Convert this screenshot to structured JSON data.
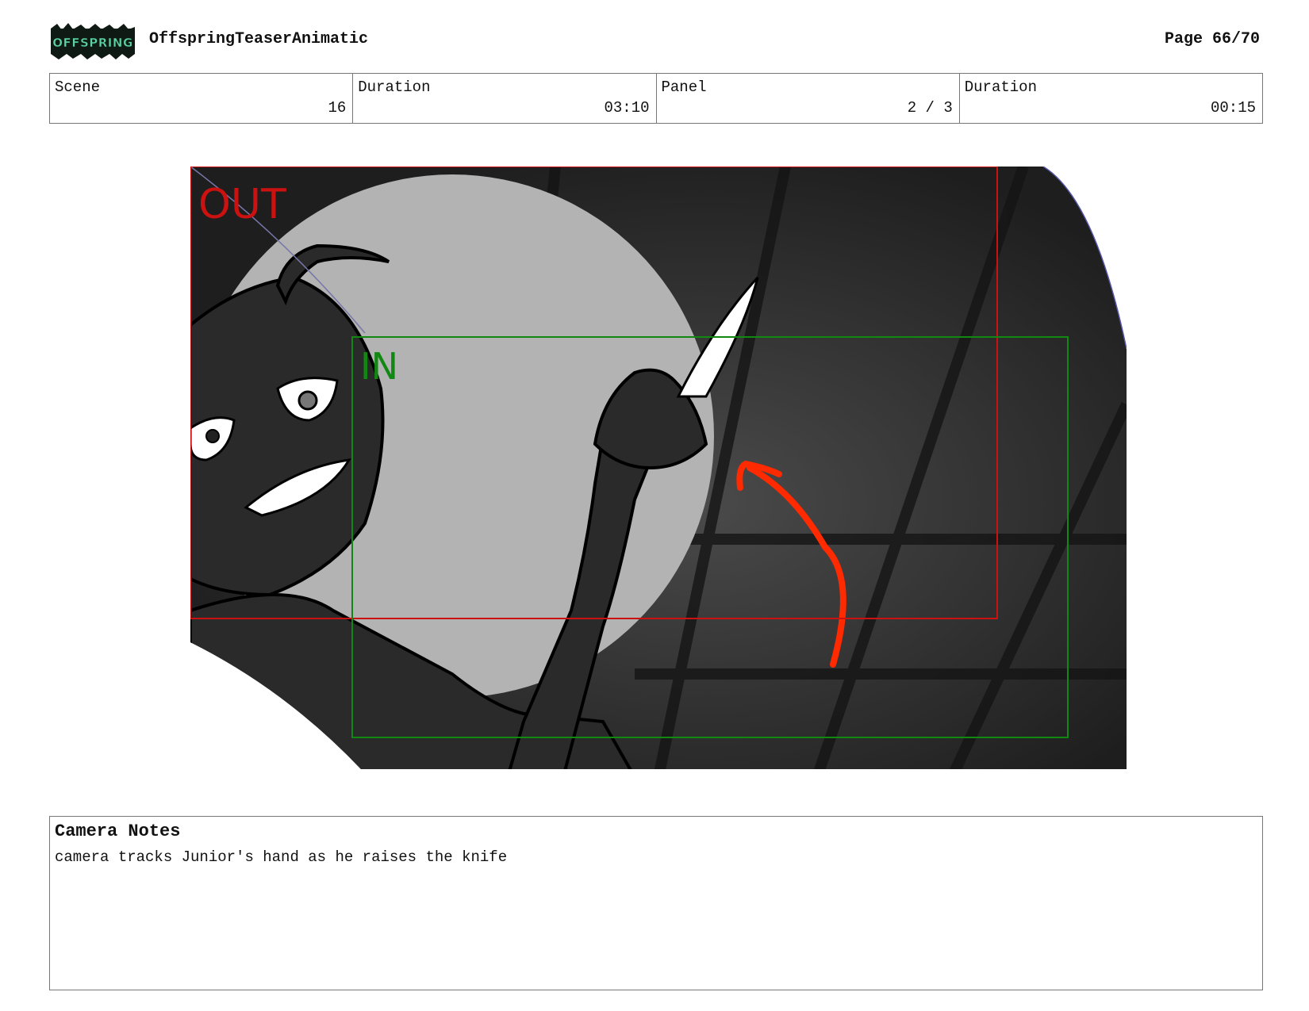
{
  "header": {
    "logo_text": "OFFSPRING",
    "project_title": "OffspringTeaserAnimatic",
    "page": "Page 66/70"
  },
  "info": {
    "scene_label": "Scene",
    "scene_value": "16",
    "duration_label": "Duration",
    "duration_value": "03:10",
    "panel_label": "Panel",
    "panel_value": "2 / 3",
    "panel_duration_label": "Duration",
    "panel_duration_value": "00:15"
  },
  "frame": {
    "out_label": "OUT",
    "in_label": "IN",
    "out_color": "#cc1111",
    "in_color": "#118811",
    "arrow_color": "#ff2a00"
  },
  "notes": {
    "title": "Camera Notes",
    "text": "camera tracks Junior's hand as he raises the knife"
  }
}
